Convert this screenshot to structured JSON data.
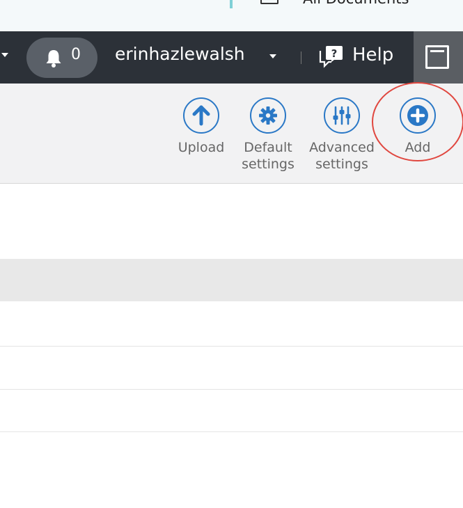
{
  "top_strip": {
    "doc_label": "All Documents"
  },
  "navbar": {
    "notification_count": "0",
    "username": "erinhazlewalsh",
    "help_label": "Help"
  },
  "toolbar": {
    "upload_label": "Upload",
    "default_settings_label": "Default\nsettings",
    "advanced_settings_label": "Advanced\nsettings",
    "add_label": "Add"
  },
  "colors": {
    "navbar_bg": "#2c3138",
    "accent_blue": "#2a78c6",
    "highlight_red": "#e0473f"
  }
}
